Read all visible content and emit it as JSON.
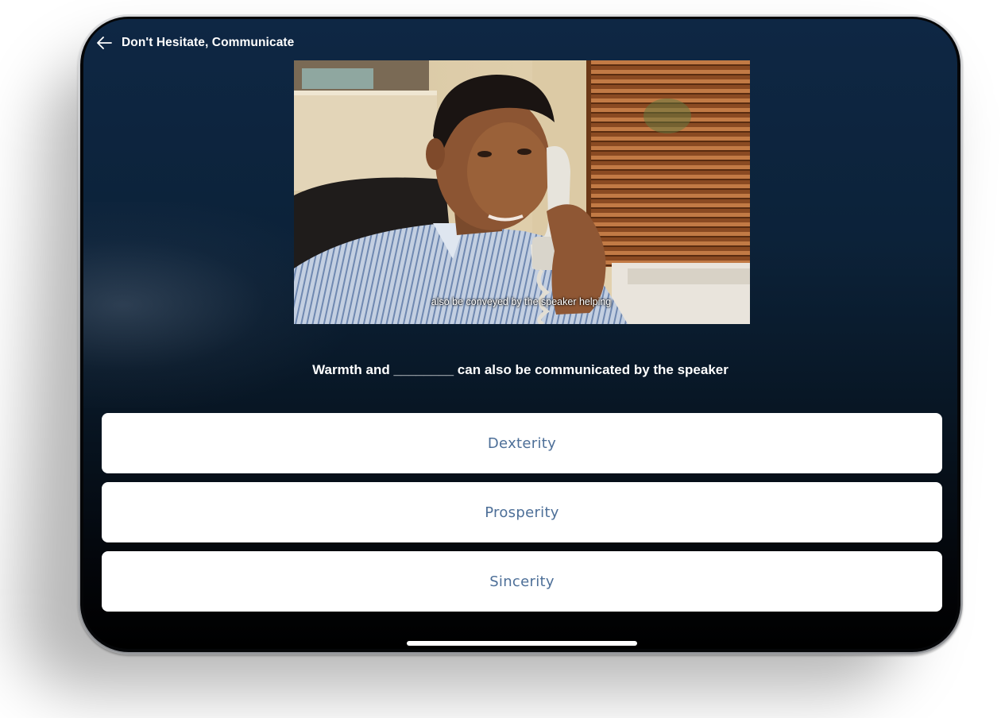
{
  "header": {
    "title": "Don't Hesitate, Communicate",
    "back_icon": "arrow-left-icon"
  },
  "video": {
    "caption": "also be conveyed by the speaker helping"
  },
  "question": {
    "text": "Warmth and ________ can also be communicated by the speaker"
  },
  "answers": [
    {
      "label": "Dexterity"
    },
    {
      "label": "Prosperity"
    },
    {
      "label": "Sincerity"
    }
  ],
  "colors": {
    "background_top": "#0e2744",
    "background_bottom": "#000000",
    "answer_text": "#4d6f98",
    "answer_bg": "#ffffff"
  }
}
